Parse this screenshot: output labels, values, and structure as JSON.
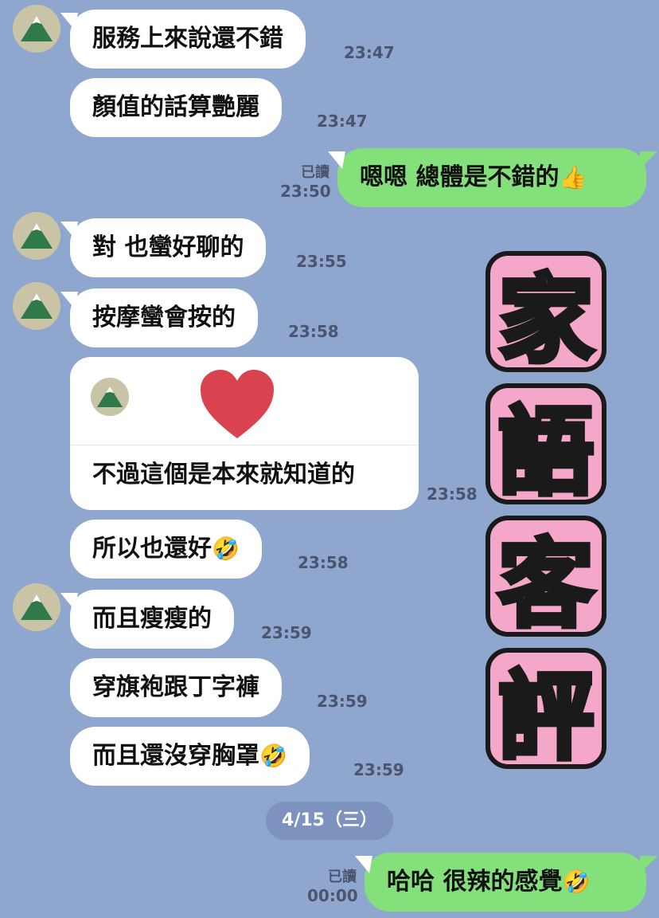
{
  "messages": [
    {
      "text": "服務上來說還不錯",
      "time": "23:47"
    },
    {
      "text": "顏值的話算艷麗",
      "time": "23:47"
    },
    {
      "text": "嗯嗯 總體是不錯的",
      "emoji": "👍",
      "time": "23:50",
      "read": "已讀"
    },
    {
      "text": "對 也蠻好聊的",
      "time": "23:55"
    },
    {
      "text": "按摩蠻會按的",
      "time": "23:58"
    },
    {
      "text": "不過這個是本來就知道的",
      "time": "23:58"
    },
    {
      "text": "所以也還好",
      "emoji": "🤣",
      "time": "23:58"
    },
    {
      "text": "而且瘦瘦的",
      "time": "23:59"
    },
    {
      "text": "穿旗袍跟丁字褲",
      "time": "23:59"
    },
    {
      "text": "而且還沒穿胸罩",
      "emoji": "🤣",
      "time": "23:59"
    },
    {
      "text": "哈哈 很辣的感覺",
      "emoji": "🤣",
      "time": "00:00",
      "read": "已讀"
    }
  ],
  "date_divider": "4/15（三）",
  "banner": [
    "家",
    "語",
    "客",
    "評"
  ],
  "icons": {
    "avatar": "mountain-avatar-icon",
    "heart": "heart-sticker"
  },
  "colors": {
    "background": "#8fa6cf",
    "incoming": "#ffffff",
    "outgoing": "#84e07a",
    "banner_pink": "#f4a7c8"
  }
}
